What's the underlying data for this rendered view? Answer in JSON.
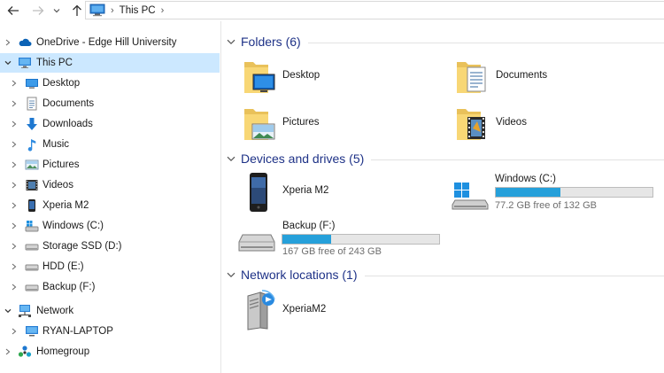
{
  "breadcrumb": {
    "items": [
      "This PC"
    ]
  },
  "nav": {
    "items": [
      {
        "label": "OneDrive - Edge Hill University",
        "icon": "onedrive-icon"
      },
      {
        "label": "This PC",
        "icon": "this-pc-icon",
        "selected": true
      },
      {
        "label": "Desktop",
        "icon": "desktop-icon"
      },
      {
        "label": "Documents",
        "icon": "documents-icon"
      },
      {
        "label": "Downloads",
        "icon": "downloads-icon"
      },
      {
        "label": "Music",
        "icon": "music-icon"
      },
      {
        "label": "Pictures",
        "icon": "pictures-icon"
      },
      {
        "label": "Videos",
        "icon": "videos-icon"
      },
      {
        "label": "Xperia M2",
        "icon": "phone-icon"
      },
      {
        "label": "Windows (C:)",
        "icon": "windows-drive-icon"
      },
      {
        "label": "Storage SSD (D:)",
        "icon": "drive-icon"
      },
      {
        "label": "HDD (E:)",
        "icon": "drive-icon"
      },
      {
        "label": "Backup (F:)",
        "icon": "drive-icon"
      },
      {
        "label": "Network",
        "icon": "network-icon"
      },
      {
        "label": "RYAN-LAPTOP",
        "icon": "computer-icon"
      },
      {
        "label": "Homegroup",
        "icon": "homegroup-icon"
      }
    ]
  },
  "content": {
    "folders": {
      "title": "Folders (6)",
      "items": [
        "Desktop",
        "Documents",
        "Pictures",
        "Videos"
      ]
    },
    "devices": {
      "title": "Devices and drives (5)",
      "items": [
        {
          "name": "Xperia M2"
        },
        {
          "name": "Windows (C:)",
          "free": "77.2 GB free of 132 GB",
          "used_fraction": 0.415
        },
        {
          "name": "Backup (F:)",
          "free": "167 GB free of 243 GB",
          "used_fraction": 0.31
        }
      ]
    },
    "network": {
      "title": "Network locations (1)",
      "items": [
        "XperiaM2"
      ]
    }
  },
  "colors": {
    "accent": "#26a0da",
    "selection": "#cce8ff",
    "group_title": "#1e3287"
  }
}
